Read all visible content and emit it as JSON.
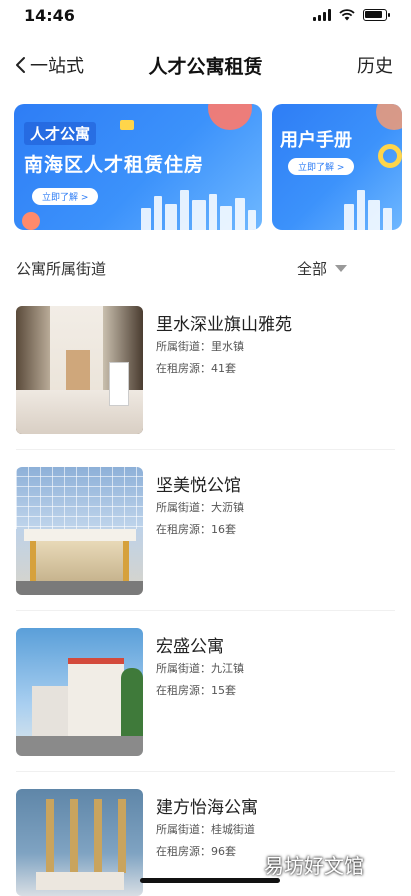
{
  "status_bar": {
    "time": "14:46"
  },
  "nav": {
    "back_label": "一站式",
    "title": "人才公寓租赁",
    "history_label": "历史"
  },
  "banners": [
    {
      "tag": "人才公寓",
      "headline": "南海区人才租赁住房",
      "button": "立即了解 >"
    },
    {
      "headline": "用户手册",
      "button": "立即了解 >"
    }
  ],
  "filter": {
    "label": "公寓所属街道",
    "selected": "全部"
  },
  "apartments": [
    {
      "name": "里水深业旗山雅苑",
      "street_label": "所属街道：",
      "street": "里水镇",
      "count_label": "在租房源：",
      "count": "41套"
    },
    {
      "name": "坚美悦公馆",
      "street_label": "所属街道：",
      "street": "大沥镇",
      "count_label": "在租房源：",
      "count": "16套"
    },
    {
      "name": "宏盛公寓",
      "street_label": "所属街道：",
      "street": "九江镇",
      "count_label": "在租房源：",
      "count": "15套"
    },
    {
      "name": "建方怡海公寓",
      "street_label": "所属街道：",
      "street": "桂城街道",
      "count_label": "在租房源：",
      "count": "96套"
    }
  ],
  "watermark": "易坊好文馆",
  "colors": {
    "banner_blue": "#2e7df5",
    "accent_red": "#ff7a6b",
    "accent_yellow": "#ffd54a"
  }
}
